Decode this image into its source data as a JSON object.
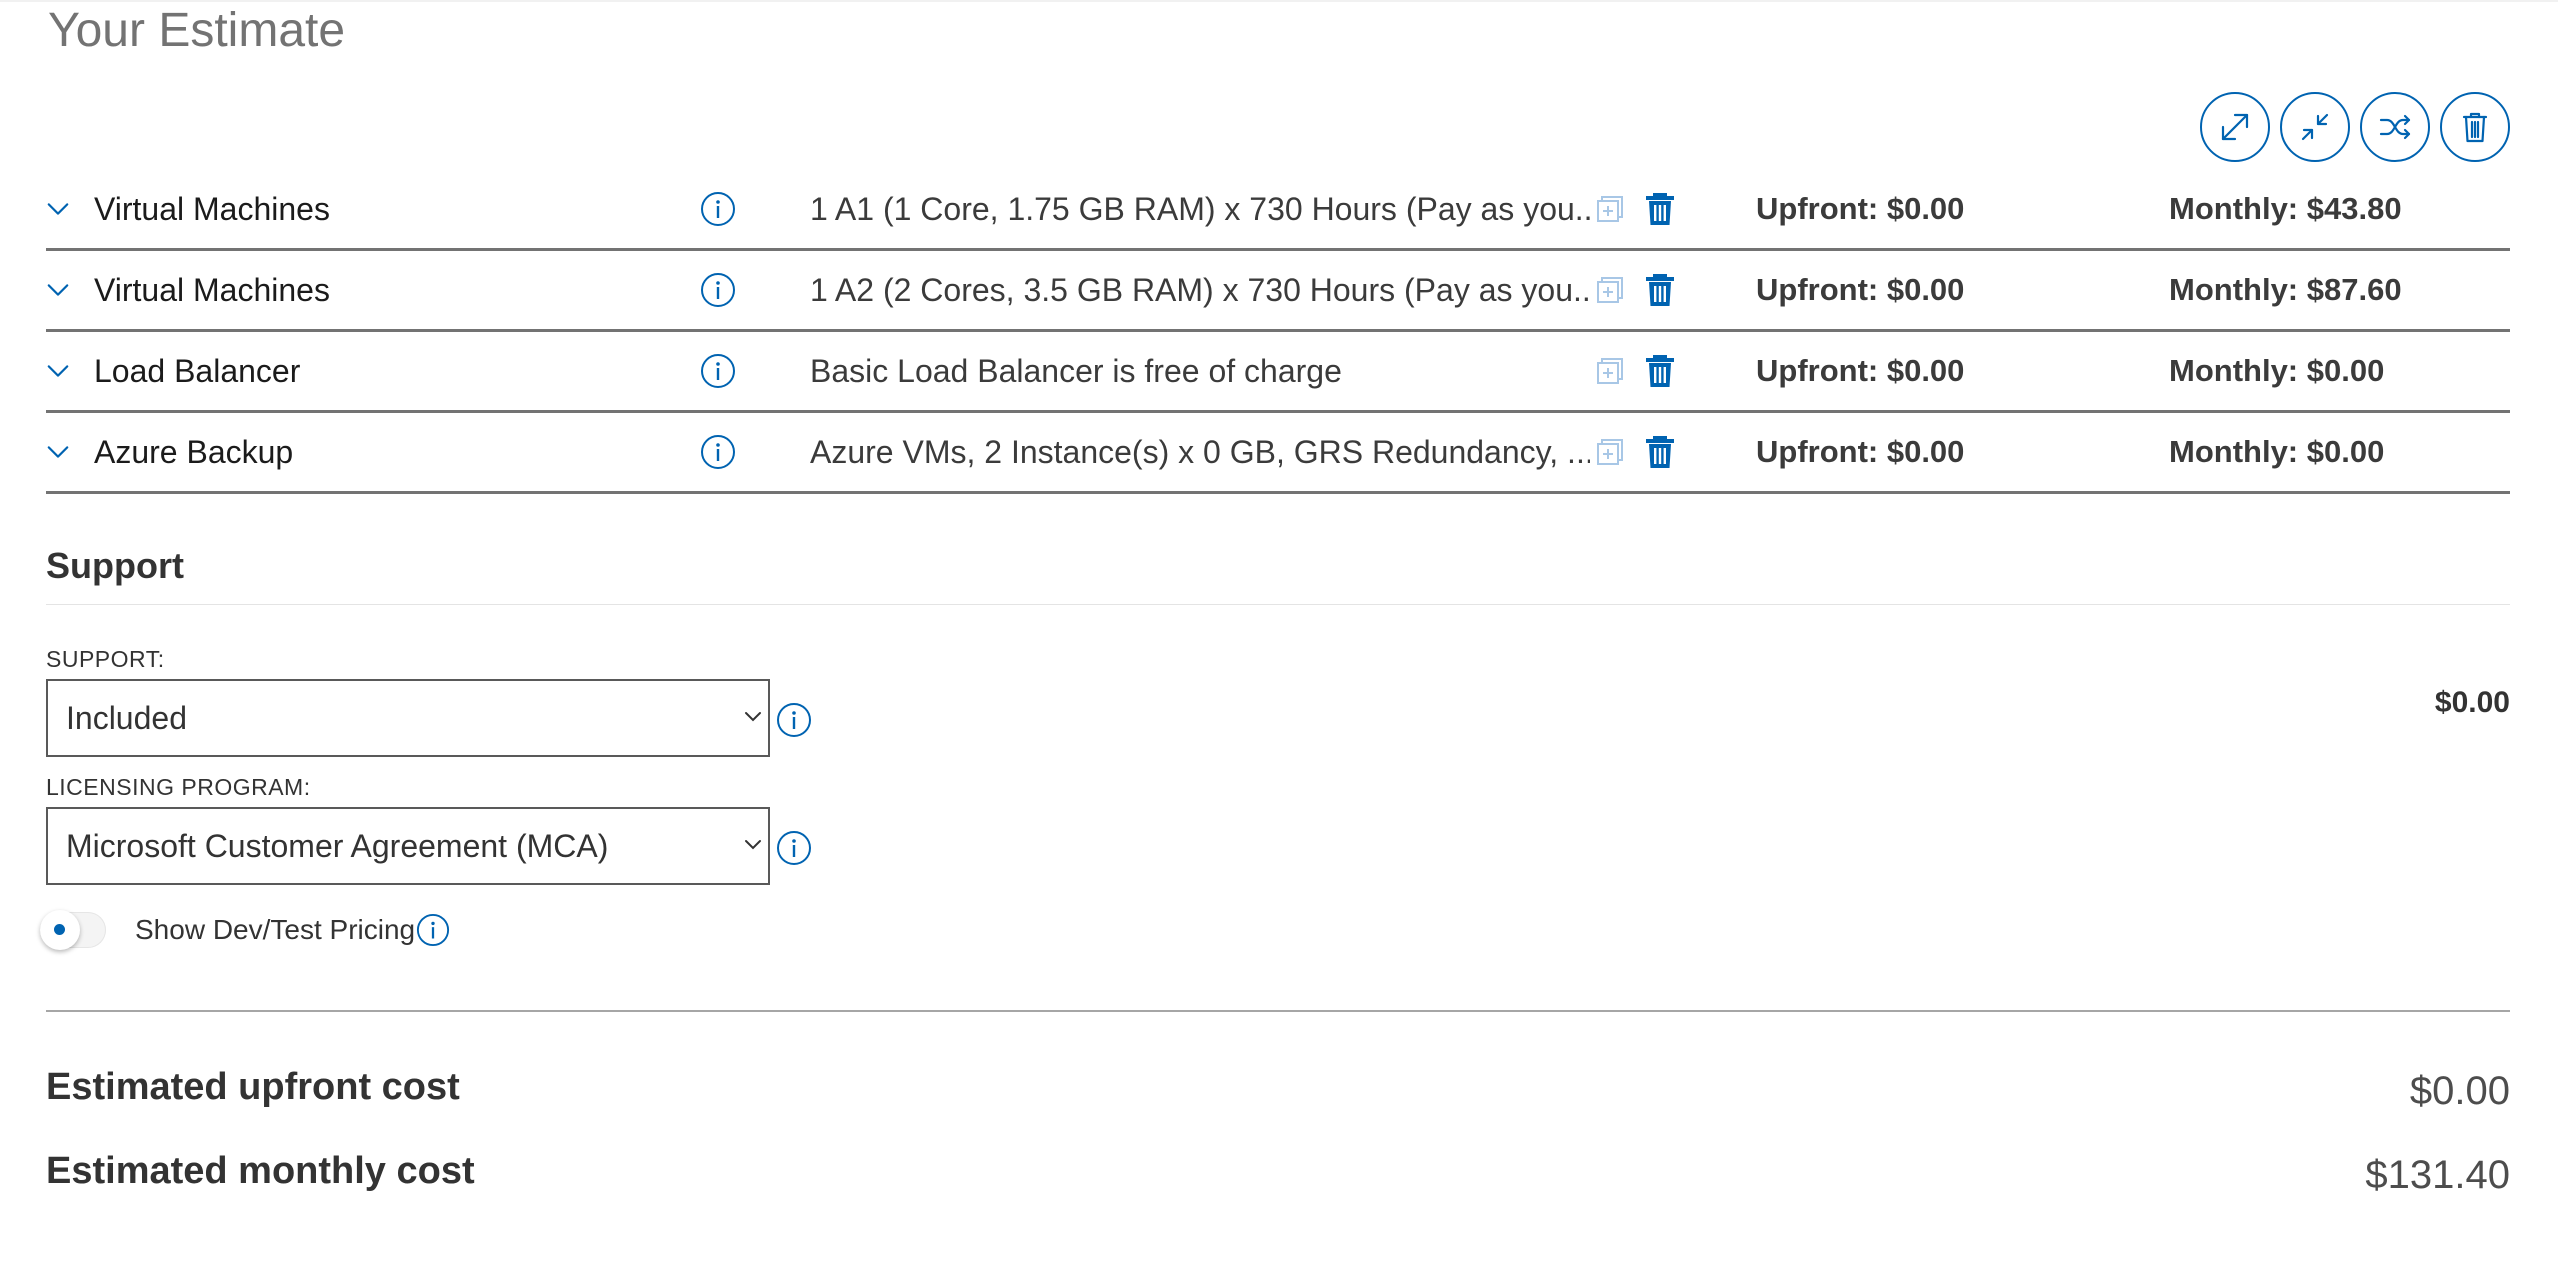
{
  "page": {
    "title": "Your Estimate"
  },
  "toolbar": {
    "buttons": [
      {
        "icon": "expand-icon"
      },
      {
        "icon": "collapse-icon"
      },
      {
        "icon": "shuffle-icon"
      },
      {
        "icon": "trash-icon"
      }
    ]
  },
  "estimate_rows": [
    {
      "service": "Virtual Machines",
      "description": "1 A1 (1 Core, 1.75 GB RAM) x 730 Hours (Pay as you...",
      "upfront": "Upfront: $0.00",
      "monthly": "Monthly: $43.80"
    },
    {
      "service": "Virtual Machines",
      "description": "1 A2 (2 Cores, 3.5 GB RAM) x 730 Hours (Pay as you...",
      "upfront": "Upfront: $0.00",
      "monthly": "Monthly: $87.60"
    },
    {
      "service": "Load Balancer",
      "description": "Basic Load Balancer is free of charge",
      "upfront": "Upfront: $0.00",
      "monthly": "Monthly: $0.00"
    },
    {
      "service": "Azure Backup",
      "description": "Azure VMs, 2 Instance(s) x 0 GB, GRS Redundancy, ...",
      "upfront": "Upfront: $0.00",
      "monthly": "Monthly: $0.00"
    }
  ],
  "support": {
    "title": "Support",
    "support_label": "SUPPORT:",
    "support_value": "Included",
    "licensing_label": "LICENSING PROGRAM:",
    "licensing_value": "Microsoft Customer Agreement (MCA)",
    "price": "$0.00",
    "devtest_label": "Show Dev/Test Pricing",
    "devtest_enabled": false
  },
  "totals": {
    "upfront_label": "Estimated upfront cost",
    "upfront_value": "$0.00",
    "monthly_label": "Estimated monthly cost",
    "monthly_value": "$131.40"
  },
  "colors": {
    "accent": "#0063b1",
    "row_divider": "#737373",
    "title_gray": "#737373"
  }
}
